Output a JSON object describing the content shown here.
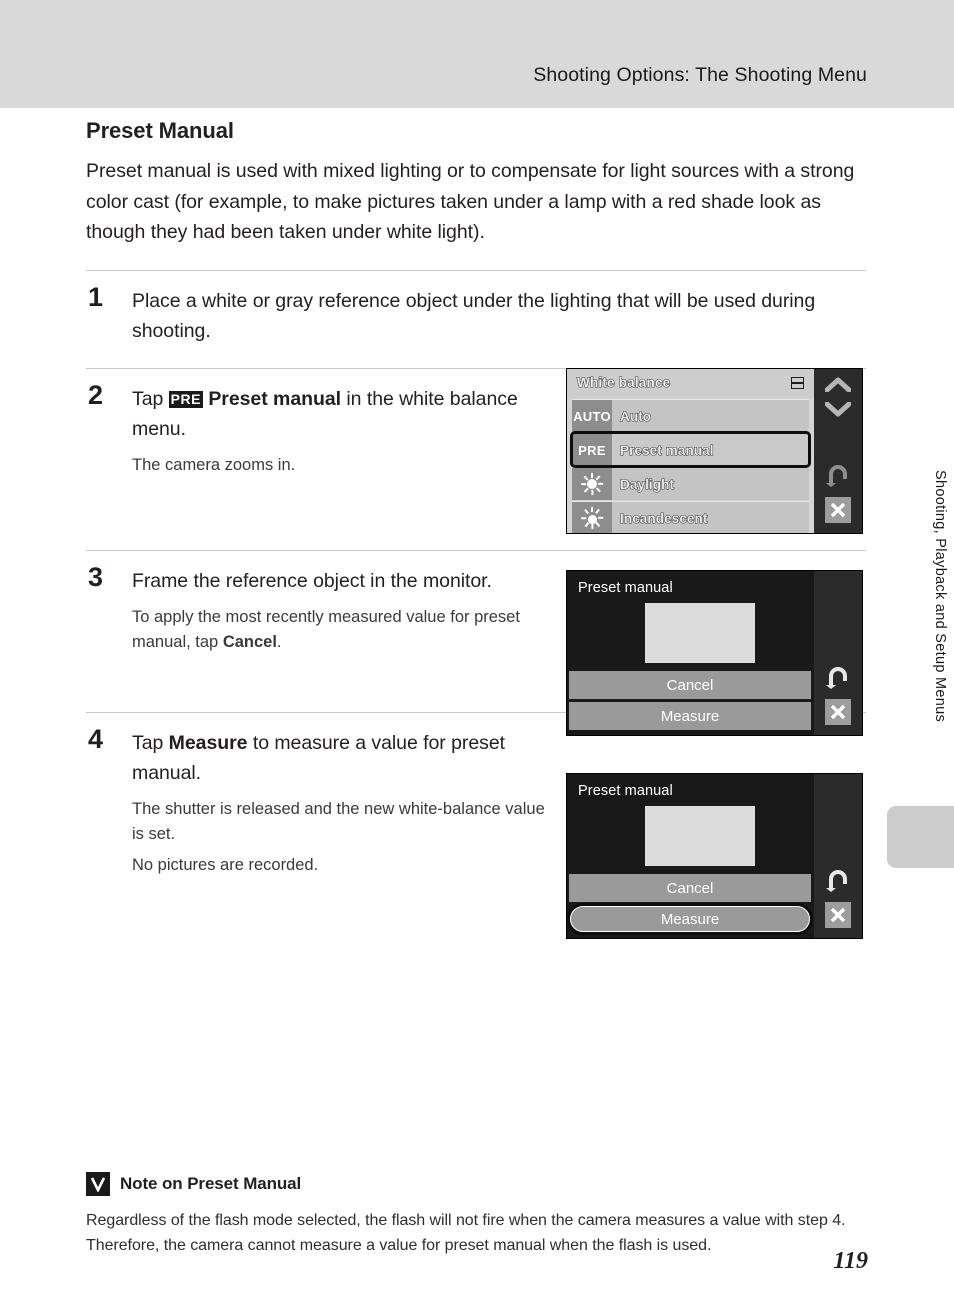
{
  "header": {
    "title": "Shooting Options: The Shooting Menu"
  },
  "section": {
    "title": "Preset Manual",
    "intro": "Preset manual is used with mixed lighting or to compensate for light sources with a strong color cast (for example, to make pictures taken under a lamp with a red shade look as though they had been taken under white light)."
  },
  "steps": [
    {
      "number": "1",
      "heading": "Place a white or gray reference object under the lighting that will be used during shooting."
    },
    {
      "number": "2",
      "heading_pre": "Tap ",
      "glyph": "PRE",
      "heading_bold": "Preset manual",
      "heading_post": " in the white balance menu.",
      "sub1": "The camera zooms in."
    },
    {
      "number": "3",
      "heading": "Frame the reference object in the monitor.",
      "sub_pre": "To apply the most recently measured value for preset manual, tap ",
      "sub_bold": "Cancel",
      "sub_post": "."
    },
    {
      "number": "4",
      "heading_pre": "Tap ",
      "heading_bold": "Measure",
      "heading_post": " to measure a value for preset manual.",
      "sub1": "The shutter is released and the new white-balance value is set.",
      "sub2": "No pictures are recorded."
    }
  ],
  "screenshots": {
    "white_balance_menu": {
      "title": "White balance",
      "menu_icon": "list-menu-icon",
      "rows": [
        {
          "badge": "AUTO",
          "label": "Auto",
          "selected": false,
          "icon": "auto-badge"
        },
        {
          "badge": "PRE",
          "label": "Preset manual",
          "selected": true,
          "icon": "pre-badge"
        },
        {
          "badge": "",
          "label": "Daylight",
          "selected": false,
          "icon": "sun-icon"
        },
        {
          "badge": "",
          "label": "Incandescent",
          "selected": false,
          "icon": "incandescent-icon"
        }
      ],
      "rail": [
        "chevron-up-icon",
        "chevron-down-icon",
        "back-arrow-icon",
        "close-icon"
      ]
    },
    "preset_manual_step3": {
      "title": "Preset manual",
      "buttons": [
        {
          "label": "Cancel",
          "selected": false
        },
        {
          "label": "Measure",
          "selected": false
        }
      ],
      "rail": [
        "back-arrow-icon",
        "close-icon"
      ]
    },
    "preset_manual_step4": {
      "title": "Preset manual",
      "buttons": [
        {
          "label": "Cancel",
          "selected": false
        },
        {
          "label": "Measure",
          "selected": true
        }
      ],
      "rail": [
        "back-arrow-icon",
        "close-icon"
      ]
    }
  },
  "side_tab": {
    "label": "Shooting, Playback and Setup Menus"
  },
  "note": {
    "icon": "check-mark-icon",
    "title": "Note on Preset Manual",
    "body": "Regardless of the flash mode selected, the flash will not fire when the camera measures a value with step 4. Therefore, the camera cannot measure a value for preset manual when the flash is used."
  },
  "page_number": "119",
  "colors": {
    "header_band": "#d9d9d9",
    "text": "#231f20",
    "rule": "#c8c8c8",
    "screen_dark": "#191919",
    "screen_light": "#d4d4d4"
  }
}
